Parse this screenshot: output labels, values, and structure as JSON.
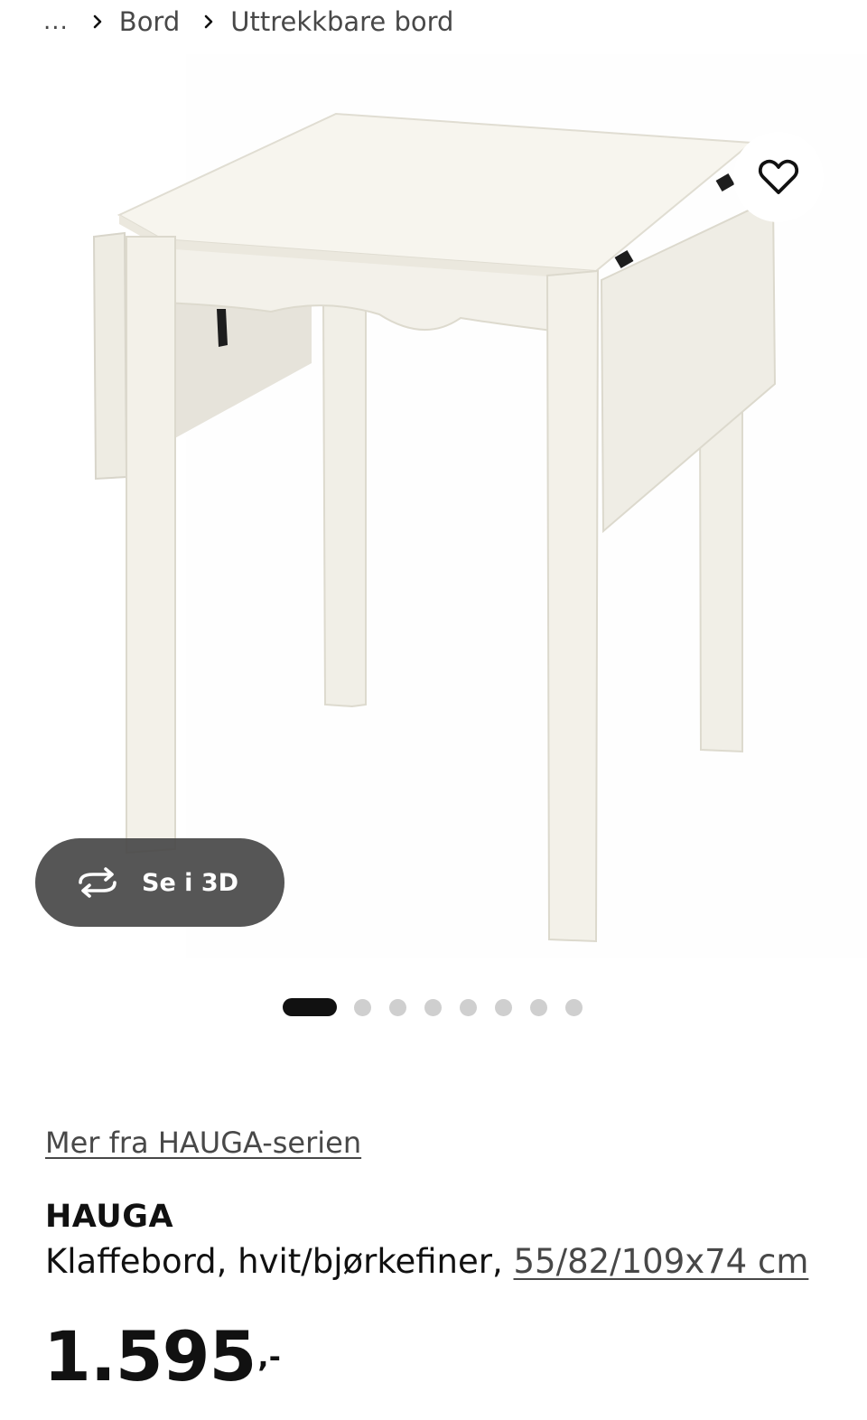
{
  "breadcrumb": {
    "ellipsis": "...",
    "items": [
      "Bord",
      "Uttrekkbare bord"
    ]
  },
  "gallery": {
    "view3d_label": "Se i 3D",
    "dot_count": 8,
    "active_index": 0
  },
  "product": {
    "series_link": "Mer fra HAUGA-serien",
    "name": "HAUGA",
    "description": "Klaffebord, hvit/bjørkefiner, ",
    "size_link": "55/82/109x74 cm",
    "price_integer": "1.595",
    "price_suffix": ",-"
  },
  "icons": {
    "breadcrumb_separator": "chevron-right-icon",
    "favorite": "heart-outline-icon",
    "view3d": "rotate-3d-icon"
  },
  "colors": {
    "text_primary": "#111111",
    "text_secondary": "#484848",
    "dot_active": "#111111",
    "dot_inactive": "#cfcfcf",
    "view3d_bg": "#484848"
  }
}
